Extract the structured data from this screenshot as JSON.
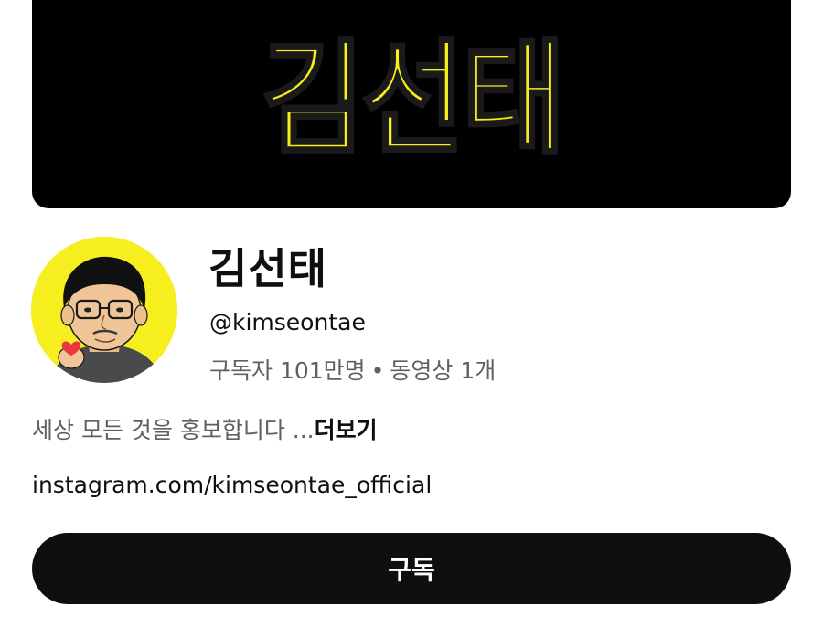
{
  "banner": {
    "logo_text": "김선태",
    "logo_color": "#f7ee1c",
    "background": "#000000"
  },
  "avatar": {
    "background": "#f6ee1e",
    "description": "illustrated-portrait-avatar"
  },
  "channel": {
    "name": "김선태",
    "handle": "@kimseontae",
    "subscribers": "구독자 101만명",
    "separator": "•",
    "videos": "동영상 1개"
  },
  "description": {
    "text": "세상 모든 것을 홍보합니다 ...",
    "more_label": "더보기"
  },
  "link": {
    "text": "instagram.com/kimseontae_official"
  },
  "subscribe_button": {
    "label": "구독",
    "background": "#0f0f0f",
    "text_color": "#ffffff"
  }
}
